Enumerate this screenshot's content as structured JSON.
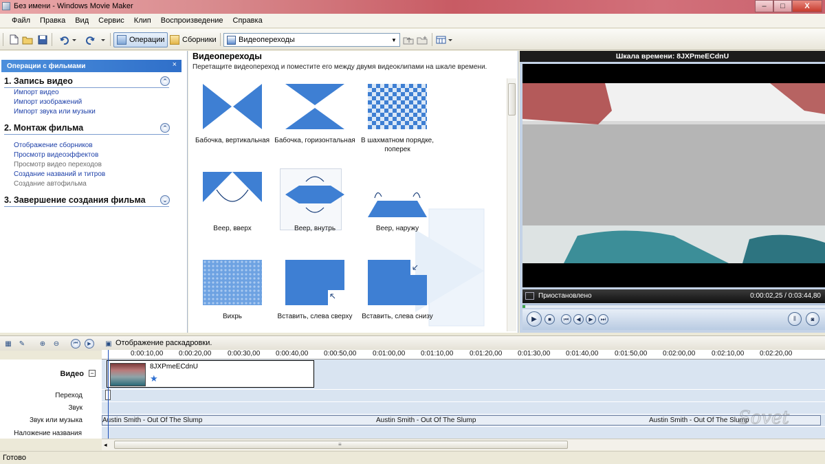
{
  "window": {
    "title": "Без имени - Windows Movie Maker",
    "controls": [
      "–",
      "□",
      "X"
    ]
  },
  "menu": [
    "Файл",
    "Правка",
    "Вид",
    "Сервис",
    "Клип",
    "Воспроизведение",
    "Справка"
  ],
  "toolbar": {
    "operations_label": "Операции",
    "collections_label": "Сборники",
    "collection_select": "Видеопереходы"
  },
  "tasks": {
    "header": "Операции с фильмами",
    "close": "×",
    "sections": [
      {
        "title": "1. Запись видео",
        "links": [
          "Импорт видео",
          "Импорт изображений",
          "Импорт звука или музыки"
        ]
      },
      {
        "title": "2. Монтаж фильма",
        "links": [
          "Отображение сборников",
          "Просмотр видеоэффектов",
          "Просмотр видео переходов",
          "Создание названий и титров",
          "Создание автофильма"
        ]
      },
      {
        "title": "3. Завершение создания фильма",
        "links": []
      }
    ]
  },
  "content": {
    "title": "Видеопереходы",
    "subtitle": "Перетащите видеопереход и поместите его между двумя видеоклипами на шкале времени.",
    "tiles": [
      "Бабочка, вертикальная",
      "Бабочка, горизонтальная",
      "В шахматном порядке, поперек",
      "Веер, вверх",
      "Веер, внутрь",
      "Веер, наружу",
      "Вихрь",
      "Вставить, слева сверху",
      "Вставить, слева снизу"
    ]
  },
  "preview": {
    "title": "Шкала времени: 8JXPmeECdnU",
    "status": "Приостановлено",
    "time": "0:00:02,25 / 0:03:44,80",
    "progress_fraction": 0.01
  },
  "timeline": {
    "view_label": "Отображение раскадровки.",
    "ticks": [
      "0:00:10,00",
      "0:00:20,00",
      "0:00:30,00",
      "0:00:40,00",
      "0:00:50,00",
      "0:01:00,00",
      "0:01:10,00",
      "0:01:20,00",
      "0:01:30,00",
      "0:01:40,00",
      "0:01:50,00",
      "0:02:00,00",
      "0:02:10,00",
      "0:02:20,00"
    ],
    "tracks": [
      "Видео",
      "Переход",
      "Звук",
      "Звук или музыка",
      "Наложение названия"
    ],
    "expand": "−",
    "clip_name": "8JXPmeECdnU",
    "audio_label": "Austin Smith - Out Of The Slump"
  },
  "statusbar": "Готово",
  "watermark": "Sovet"
}
